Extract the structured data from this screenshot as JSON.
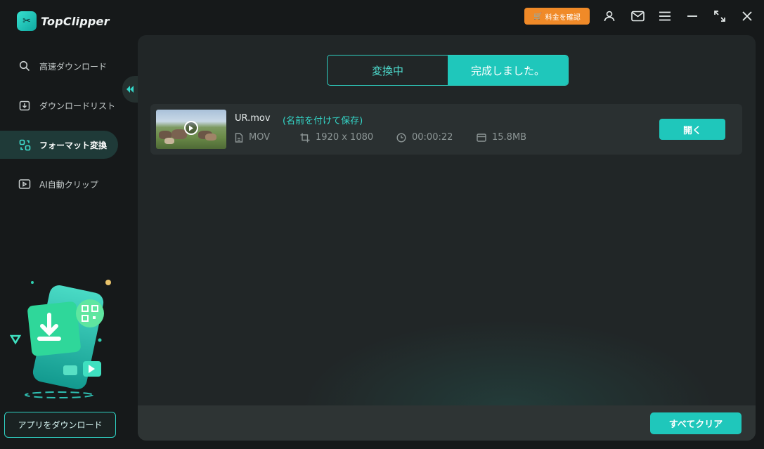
{
  "app": {
    "name": "TopClipper"
  },
  "titlebar": {
    "price_label": "料金を確認",
    "icons": [
      "user-icon",
      "mail-icon",
      "menu-icon",
      "minimize-icon",
      "maximize-icon",
      "close-icon"
    ]
  },
  "sidebar": {
    "items": [
      {
        "label": "高速ダウンロード",
        "icon": "search-icon",
        "active": false
      },
      {
        "label": "ダウンロードリスト",
        "icon": "download-list-icon",
        "active": false
      },
      {
        "label": "フォーマット変換",
        "icon": "convert-icon",
        "active": true
      },
      {
        "label": "AI自動クリップ",
        "icon": "ai-clip-icon",
        "active": false
      }
    ],
    "app_download_label": "アプリをダウンロード"
  },
  "main": {
    "tabs": [
      {
        "label": "変換中",
        "active": false
      },
      {
        "label": "完成しました。",
        "active": true
      }
    ],
    "files": [
      {
        "name": "UR.mov",
        "rename_label": "(名前を付けて保存)",
        "format": "MOV",
        "resolution": "1920 x 1080",
        "duration": "00:00:22",
        "size": "15.8MB",
        "open_label": "開く"
      }
    ],
    "clear_all_label": "すべてクリア"
  },
  "colors": {
    "accent": "#1fc7bb",
    "price_button": "#f08a28",
    "background": "#16191a",
    "panel": "#212627"
  }
}
